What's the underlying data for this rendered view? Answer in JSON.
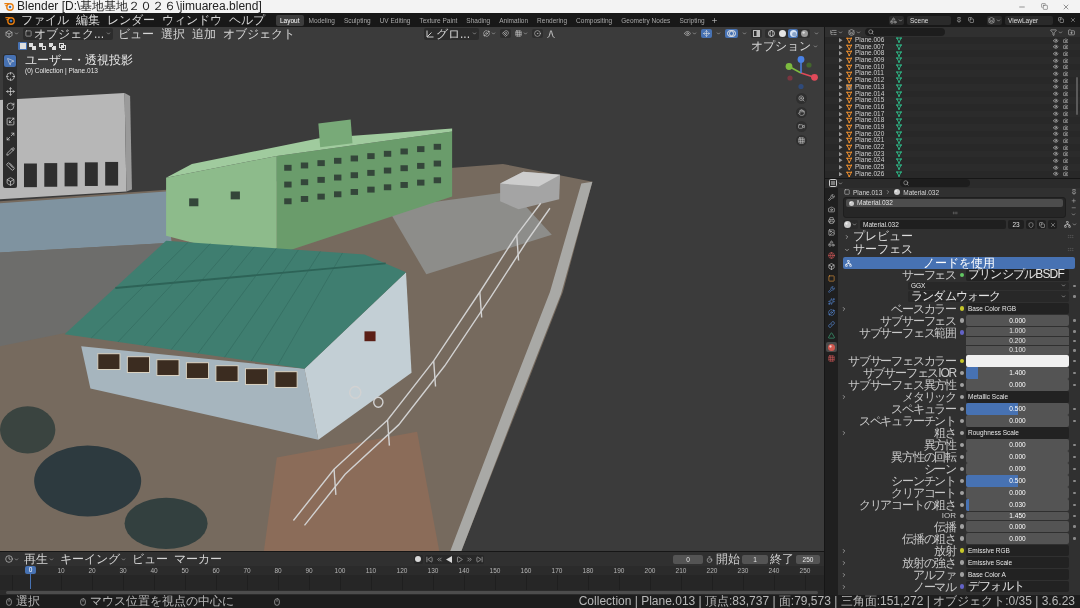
{
  "window": {
    "title": "Blender [D:\\基地基地２０２６\\jimuarea.blend]"
  },
  "top_bar": {
    "menus": [
      "ファイル",
      "編集",
      "レンダー",
      "ウィンドウ",
      "ヘルプ"
    ],
    "workspaces": [
      {
        "label": "Layout",
        "selected": true
      },
      {
        "label": "Modeling",
        "selected": false
      },
      {
        "label": "Sculpting",
        "selected": false
      },
      {
        "label": "UV Editing",
        "selected": false
      },
      {
        "label": "Texture Paint",
        "selected": false
      },
      {
        "label": "Shading",
        "selected": false
      },
      {
        "label": "Animation",
        "selected": false
      },
      {
        "label": "Rendering",
        "selected": false
      },
      {
        "label": "Compositing",
        "selected": false
      },
      {
        "label": "Geometry Nodes",
        "selected": false
      },
      {
        "label": "Scripting",
        "selected": false
      }
    ],
    "scene": "Scene",
    "view_layer": "ViewLayer"
  },
  "viewport": {
    "mode": "オブジェク...",
    "menus": [
      "ビュー",
      "選択",
      "追加",
      "オブジェクト"
    ],
    "orientation": "グロ...",
    "snapping": [
      {
        "kind": "snap",
        "on": false
      },
      {
        "kind": "proportional",
        "on": false
      }
    ],
    "toggles": [
      {
        "kind": "gizmo",
        "on": true
      },
      {
        "kind": "overlay",
        "on": true
      },
      {
        "kind": "xray",
        "on": false
      }
    ],
    "shading": [
      {
        "kind": "wireframe",
        "selected": false
      },
      {
        "kind": "solid",
        "selected": false
      },
      {
        "kind": "material",
        "selected": true
      },
      {
        "kind": "rendered",
        "selected": false
      }
    ],
    "select_modes": [
      {
        "kind": "set",
        "selected": true
      },
      {
        "kind": "extend",
        "selected": false
      },
      {
        "kind": "subtract",
        "selected": false
      },
      {
        "kind": "difference",
        "selected": false
      },
      {
        "kind": "intersect",
        "selected": false
      }
    ],
    "options": "オプション",
    "view_name": "ユーザー・透視投影",
    "object_info": "(0) Collection | Plane.013",
    "tools": [
      {
        "kind": "select",
        "selected": true
      },
      {
        "kind": "cursor",
        "selected": false
      },
      {
        "kind": "move",
        "selected": false
      },
      {
        "kind": "rotate",
        "selected": false
      },
      {
        "kind": "scale",
        "selected": false
      },
      {
        "kind": "transform",
        "selected": false
      },
      {
        "kind": "annotate",
        "selected": false
      },
      {
        "kind": "measure",
        "selected": false
      },
      {
        "kind": "add_cube",
        "selected": false
      }
    ]
  },
  "outliner": {
    "rows": [
      {
        "name": "Plane.006",
        "selected": false
      },
      {
        "name": "Plane.007",
        "selected": false
      },
      {
        "name": "Plane.008",
        "selected": false
      },
      {
        "name": "Plane.009",
        "selected": false
      },
      {
        "name": "Plane.010",
        "selected": false
      },
      {
        "name": "Plane.011",
        "selected": false
      },
      {
        "name": "Plane.012",
        "selected": false
      },
      {
        "name": "Plane.013",
        "selected": true
      },
      {
        "name": "Plane.014",
        "selected": false
      },
      {
        "name": "Plane.015",
        "selected": false
      },
      {
        "name": "Plane.016",
        "selected": false
      },
      {
        "name": "Plane.017",
        "selected": false
      },
      {
        "name": "Plane.018",
        "selected": false
      },
      {
        "name": "Plane.019",
        "selected": false
      },
      {
        "name": "Plane.020",
        "selected": false
      },
      {
        "name": "Plane.021",
        "selected": false
      },
      {
        "name": "Plane.022",
        "selected": false
      },
      {
        "name": "Plane.023",
        "selected": false
      },
      {
        "name": "Plane.024",
        "selected": false
      },
      {
        "name": "Plane.025",
        "selected": false
      },
      {
        "name": "Plane.026",
        "selected": false
      }
    ]
  },
  "properties": {
    "tabs": [
      {
        "kind": "tool",
        "selected": false
      },
      {
        "kind": "render",
        "selected": false
      },
      {
        "kind": "output",
        "selected": false
      },
      {
        "kind": "view_layer",
        "selected": false
      },
      {
        "kind": "scene",
        "selected": false
      },
      {
        "kind": "world",
        "selected": false
      },
      {
        "kind": "collection",
        "selected": false
      },
      {
        "kind": "object",
        "selected": false
      },
      {
        "kind": "modifiers",
        "selected": false
      },
      {
        "kind": "particles",
        "selected": false
      },
      {
        "kind": "physics",
        "selected": false
      },
      {
        "kind": "constraints",
        "selected": false
      },
      {
        "kind": "data",
        "selected": false
      },
      {
        "kind": "material",
        "selected": true
      },
      {
        "kind": "texture",
        "selected": false
      }
    ],
    "breadcrumb": {
      "object": "Plane.013",
      "material": "Material.032"
    },
    "slots": [
      {
        "name": "Material.032",
        "selected": true
      }
    ],
    "material": {
      "name": "Material.032",
      "users": "23"
    },
    "panels": [
      {
        "label": "プレビュー",
        "expanded": false
      },
      {
        "label": "サーフェス",
        "expanded": true,
        "use_nodes": "ノードを使用",
        "inputs": [
          {
            "kind": "link",
            "label": "サーフェス",
            "socket": {
              "color": "#63c763"
            },
            "value": "プリンシプルBSDF"
          },
          {
            "kind": "dropdown",
            "value": "GGX"
          },
          {
            "kind": "dropdown",
            "value": "ランダムウォーク"
          },
          {
            "kind": "link",
            "label": "ベースカラー",
            "socket": {
              "color": "#c7c729"
            },
            "value": "Base Color RGB",
            "expanded": false
          },
          {
            "kind": "slider",
            "label": "サブサーフェス",
            "socket": {
              "color": "#a1a1a1"
            },
            "value": "0.000",
            "level": 0
          },
          {
            "kind": "vector",
            "label": "サブサーフェス範囲",
            "socket": {
              "color": "#6363c7"
            },
            "values": [
              "1.000",
              "0.200",
              "0.100"
            ]
          },
          {
            "kind": "color",
            "label": "サブサーフェスカラー",
            "socket": {
              "color": "#c7c729"
            },
            "color": "#f0f0f0"
          },
          {
            "kind": "slider",
            "label": "サブサーフェスIOR",
            "socket": {
              "color": "#a1a1a1"
            },
            "value": "1.400",
            "level": 0.12
          },
          {
            "kind": "slider",
            "label": "サブサーフェス異方性",
            "socket": {
              "color": "#a1a1a1"
            },
            "value": "0.000",
            "level": 0
          },
          {
            "kind": "link",
            "label": "メタリック",
            "socket": {
              "color": "#a1a1a1"
            },
            "value": "Metallic Scale",
            "expanded": false
          },
          {
            "kind": "slider",
            "label": "スペキュラー",
            "socket": {
              "color": "#a1a1a1"
            },
            "value": "0.500",
            "level": 0.5
          },
          {
            "kind": "slider",
            "label": "スペキュラーチント",
            "socket": {
              "color": "#a1a1a1"
            },
            "value": "0.000",
            "level": 0
          },
          {
            "kind": "link",
            "label": "粗さ",
            "socket": {
              "color": "#a1a1a1"
            },
            "value": "Roughness Scale",
            "expanded": false
          },
          {
            "kind": "slider",
            "label": "異方性",
            "socket": {
              "color": "#a1a1a1"
            },
            "value": "0.000",
            "level": 0
          },
          {
            "kind": "slider",
            "label": "異方性の回転",
            "socket": {
              "color": "#a1a1a1"
            },
            "value": "0.000",
            "level": 0
          },
          {
            "kind": "slider",
            "label": "シーン",
            "socket": {
              "color": "#a1a1a1"
            },
            "value": "0.000",
            "level": 0
          },
          {
            "kind": "slider",
            "label": "シーンチント",
            "socket": {
              "color": "#a1a1a1"
            },
            "value": "0.500",
            "level": 0.5
          },
          {
            "kind": "slider",
            "label": "クリアコート",
            "socket": {
              "color": "#a1a1a1"
            },
            "value": "0.000",
            "level": 0
          },
          {
            "kind": "slider",
            "label": "クリアコートの粗さ",
            "socket": {
              "color": "#a1a1a1"
            },
            "value": "0.030",
            "level": 0.03
          },
          {
            "kind": "number",
            "label": "IOR",
            "socket": {
              "color": "#a1a1a1"
            },
            "value": "1.450"
          },
          {
            "kind": "slider",
            "label": "伝播",
            "socket": {
              "color": "#a1a1a1"
            },
            "value": "0.000",
            "level": 0
          },
          {
            "kind": "slider",
            "label": "伝播の粗さ",
            "socket": {
              "color": "#a1a1a1"
            },
            "value": "0.000",
            "level": 0
          },
          {
            "kind": "link",
            "label": "放射",
            "socket": {
              "color": "#c7c729"
            },
            "value": "Emissive RGB",
            "expanded": false
          },
          {
            "kind": "link",
            "label": "放射の強さ",
            "socket": {
              "color": "#a1a1a1"
            },
            "value": "Emissive Scale",
            "expanded": false
          },
          {
            "kind": "link",
            "label": "アルファ",
            "socket": {
              "color": "#a1a1a1"
            },
            "value": "Base Color A",
            "expanded": false
          },
          {
            "kind": "link",
            "label": "ノーマル",
            "socket": {
              "color": "#6363c7"
            },
            "value": "デフォルト",
            "expanded": false
          }
        ]
      }
    ]
  },
  "timeline": {
    "menus": [
      {
        "label": "再生",
        "kind": "dropdown"
      },
      {
        "label": "キーイング",
        "kind": "dropdown"
      },
      {
        "label": "ビュー",
        "kind": "menu"
      },
      {
        "label": "マーカー",
        "kind": "menu"
      }
    ],
    "current_frame": "0",
    "start_label": "開始",
    "start": "1",
    "end_label": "終了",
    "end": "250",
    "ruler": [
      "10",
      "20",
      "30",
      "40",
      "50",
      "60",
      "70",
      "80",
      "90",
      "100",
      "110",
      "120",
      "130",
      "140",
      "150",
      "160",
      "170",
      "180",
      "190",
      "200",
      "210",
      "220",
      "230",
      "240",
      "250"
    ],
    "playhead": "0"
  },
  "status_bar": {
    "hints": [
      "選択",
      "マウス位置を視点の中心に"
    ],
    "stats": "Collection | Plane.013 | 頂点:83,737 | 面:79,573 | 三角面:151,272 | オブジェクト:0/35 | 3.6.23"
  }
}
